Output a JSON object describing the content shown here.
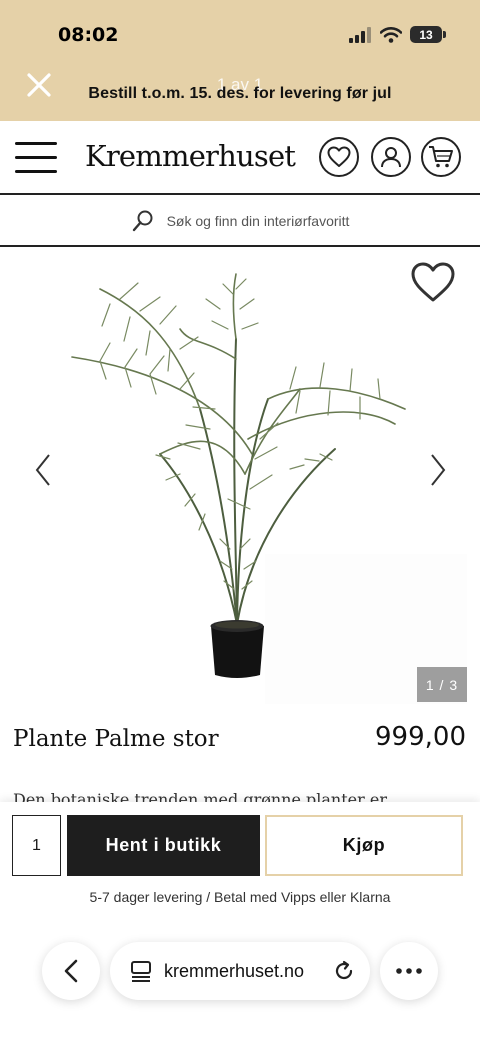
{
  "status_bar": {
    "time": "08:02",
    "battery": "13"
  },
  "banner": {
    "counter": "1 av 1",
    "text": "Bestill t.o.m. 15. des. for levering før jul",
    "close_icon": "close-icon"
  },
  "header": {
    "logo": "Kremmerhuset",
    "icons": [
      "menu-icon",
      "heart-icon",
      "user-icon",
      "cart-icon"
    ]
  },
  "search": {
    "placeholder": "Søk og finn din interiørfavoritt",
    "icon": "search-icon"
  },
  "gallery": {
    "counter": "1 / 3",
    "current_image": 1,
    "total_images": 3
  },
  "product": {
    "name": "Plante Palme stor",
    "price": "999,00",
    "description": "Den botaniske trenden med grønne planter er"
  },
  "actions": {
    "quantity": "1",
    "store_button": "Hent i butikk",
    "buy_button": "Kjøp",
    "delivery_info": "5-7 dager levering / Betal med Vipps eller Klarna"
  },
  "browser": {
    "url": "kremmerhuset.no"
  },
  "colors": {
    "banner": "#e5d1a8",
    "primary_button": "#1e1e1e",
    "counter_box": "#9e9e9e"
  }
}
